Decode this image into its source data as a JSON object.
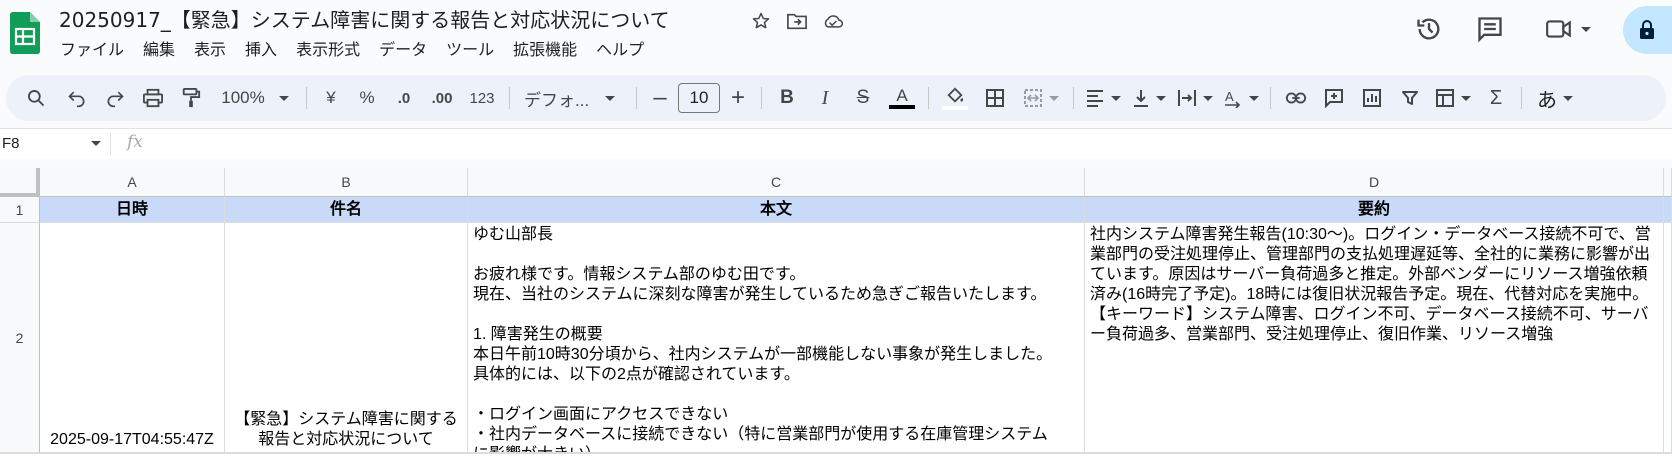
{
  "app": {
    "doc_title": "20250917_【緊急】システム障害に関する報告と対応状況について",
    "menu": [
      "ファイル",
      "編集",
      "表示",
      "挿入",
      "表示形式",
      "データ",
      "ツール",
      "拡張機能",
      "ヘルプ"
    ]
  },
  "toolbar": {
    "zoom": "100%",
    "currency": "¥",
    "percent": "%",
    "dec_decrease": ".0",
    "dec_increase": ".00",
    "number_format": "123",
    "font": "デフォ...",
    "font_size": "10",
    "input_mode": "あ"
  },
  "formula_bar": {
    "cell_ref": "F8",
    "fx": "fx"
  },
  "grid": {
    "columns": [
      "A",
      "B",
      "C",
      "D"
    ],
    "rows": [
      "1",
      "2"
    ],
    "headers": [
      "日時",
      "件名",
      "本文",
      "要約"
    ],
    "row2": {
      "date": "2025-09-17T04:55:47Z",
      "subject": "【緊急】システム障害に関する報告と対応状況について",
      "body": "ゆむ山部長\n\nお疲れ様です。情報システム部のゆむ田です。\n現在、当社のシステムに深刻な障害が発生しているため急ぎご報告いたします。\n\n1. 障害発生の概要\n本日午前10時30分頃から、社内システムが一部機能しない事象が発生しました。\n具体的には、以下の2点が確認されています。\n\n・ログイン画面にアクセスできない\n・社内データベースに接続できない（特に営業部門が使用する在庫管理システム\nに影響が大きい）",
      "summary": "社内システム障害発生報告(10:30〜)。ログイン・データベース接続不可で、営業部門の受注処理停止、管理部門の支払処理遅延等、全社的に業務に影響が出ています。原因はサーバー負荷過多と推定。外部ベンダーにリソース増強依頼済み(16時完了予定)。18時には復旧状況報告予定。現在、代替対応を実施中。\n【キーワード】システム障害、ログイン不可、データベース接続不可、サーバー負荷過多、営業部門、受注処理停止、復旧作業、リソース増強"
    }
  },
  "colors": {
    "header_fill": "#c9daf8",
    "logo_green": "#0f9d58",
    "toolbar_bg": "#edf2fa"
  },
  "icons": [
    "sheets-logo-icon",
    "star-icon",
    "move-folder-icon",
    "cloud-saved-icon",
    "history-icon",
    "comment-icon",
    "video-icon",
    "lock-icon",
    "search-icon",
    "undo-icon",
    "redo-icon",
    "print-icon",
    "paint-format-icon",
    "bold-icon",
    "italic-icon",
    "strikethrough-icon",
    "text-color-icon",
    "fill-color-icon",
    "borders-icon",
    "merge-cells-icon",
    "align-left-icon",
    "valign-bottom-icon",
    "text-wrap-icon",
    "text-rotate-icon",
    "link-icon",
    "insert-comment-icon",
    "insert-chart-icon",
    "filter-icon",
    "table-icon",
    "sum-icon"
  ]
}
